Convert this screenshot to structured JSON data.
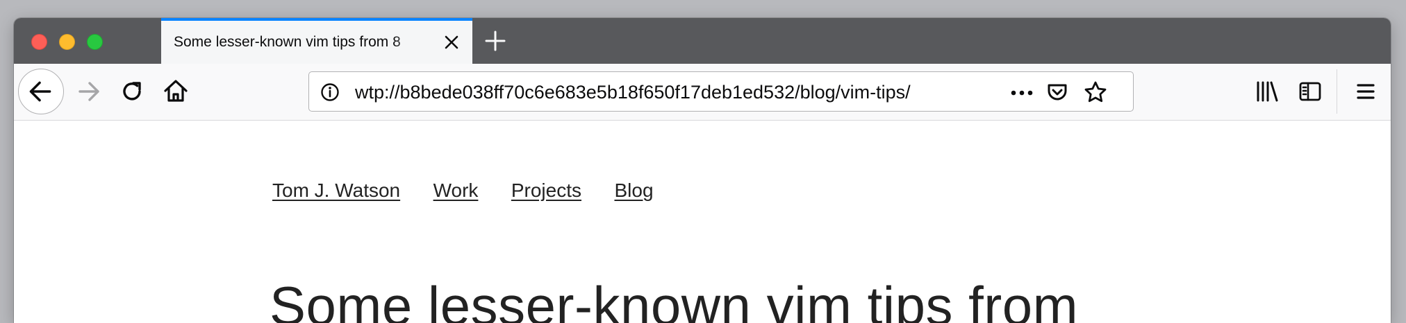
{
  "tab": {
    "title": "Some lesser-known vim tips from 8"
  },
  "toolbar": {
    "url": "wtp://b8bede038ff70c6e683e5b18f650f17deb1ed532/blog/vim-tips/"
  },
  "site_nav": {
    "items": [
      "Tom J. Watson",
      "Work",
      "Projects",
      "Blog"
    ]
  },
  "post": {
    "title": "Some lesser-known vim tips from"
  },
  "colors": {
    "tab_accent": "#0a84ff",
    "tabstrip": "#58595c",
    "navbar": "#f9f9fa"
  },
  "icons": [
    "close-icon",
    "plus-icon",
    "back-arrow-icon",
    "forward-arrow-icon",
    "reload-icon",
    "home-icon",
    "info-icon",
    "more-dots-icon",
    "pocket-icon",
    "star-icon",
    "library-icon",
    "sidebar-icon",
    "hamburger-menu-icon"
  ]
}
